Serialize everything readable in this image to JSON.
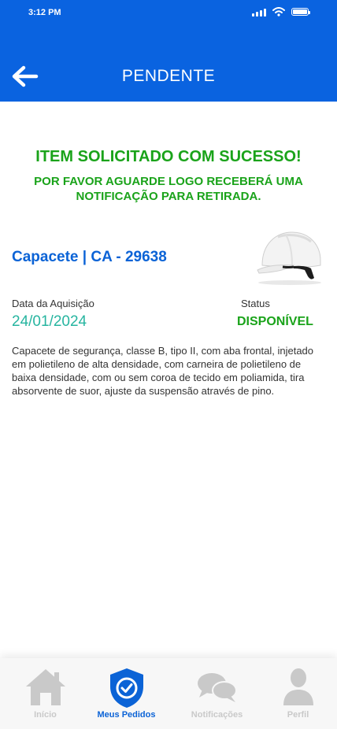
{
  "status_bar": {
    "time": "3:12 PM"
  },
  "header": {
    "title": "PENDENTE"
  },
  "message": {
    "title": "ITEM SOLICITADO COM SUCESSO!",
    "subtitle": "POR FAVOR AGUARDE LOGO RECEBERÁ UMA NOTIFICAÇÃO PARA RETIRADA."
  },
  "item": {
    "name": "Capacete | CA - 29638",
    "date_label": "Data da Aquisição",
    "date_value": "24/01/2024",
    "status_label": "Status",
    "status_value": "DISPONÍVEL",
    "description": "Capacete de segurança, classe B, tipo II, com aba frontal, injetado em polietileno de alta densidade, com carneira de polietileno de baixa densidade, com ou sem coroa de tecido em poliamida, tira absorvente de suor, ajuste da suspensão através de pino."
  },
  "nav": {
    "items": [
      {
        "label": "Início",
        "icon": "home-icon"
      },
      {
        "label": "Meus Pedidos",
        "icon": "shield-check-icon"
      },
      {
        "label": "Notificações",
        "icon": "chat-bubbles-icon"
      },
      {
        "label": "Perfil",
        "icon": "user-icon"
      }
    ],
    "active": "Meus Pedidos"
  },
  "colors": {
    "header_bg": "#0a63e0",
    "success_green": "#1aa31a",
    "date_teal": "#27b5a0",
    "item_blue": "#0b63d6"
  }
}
